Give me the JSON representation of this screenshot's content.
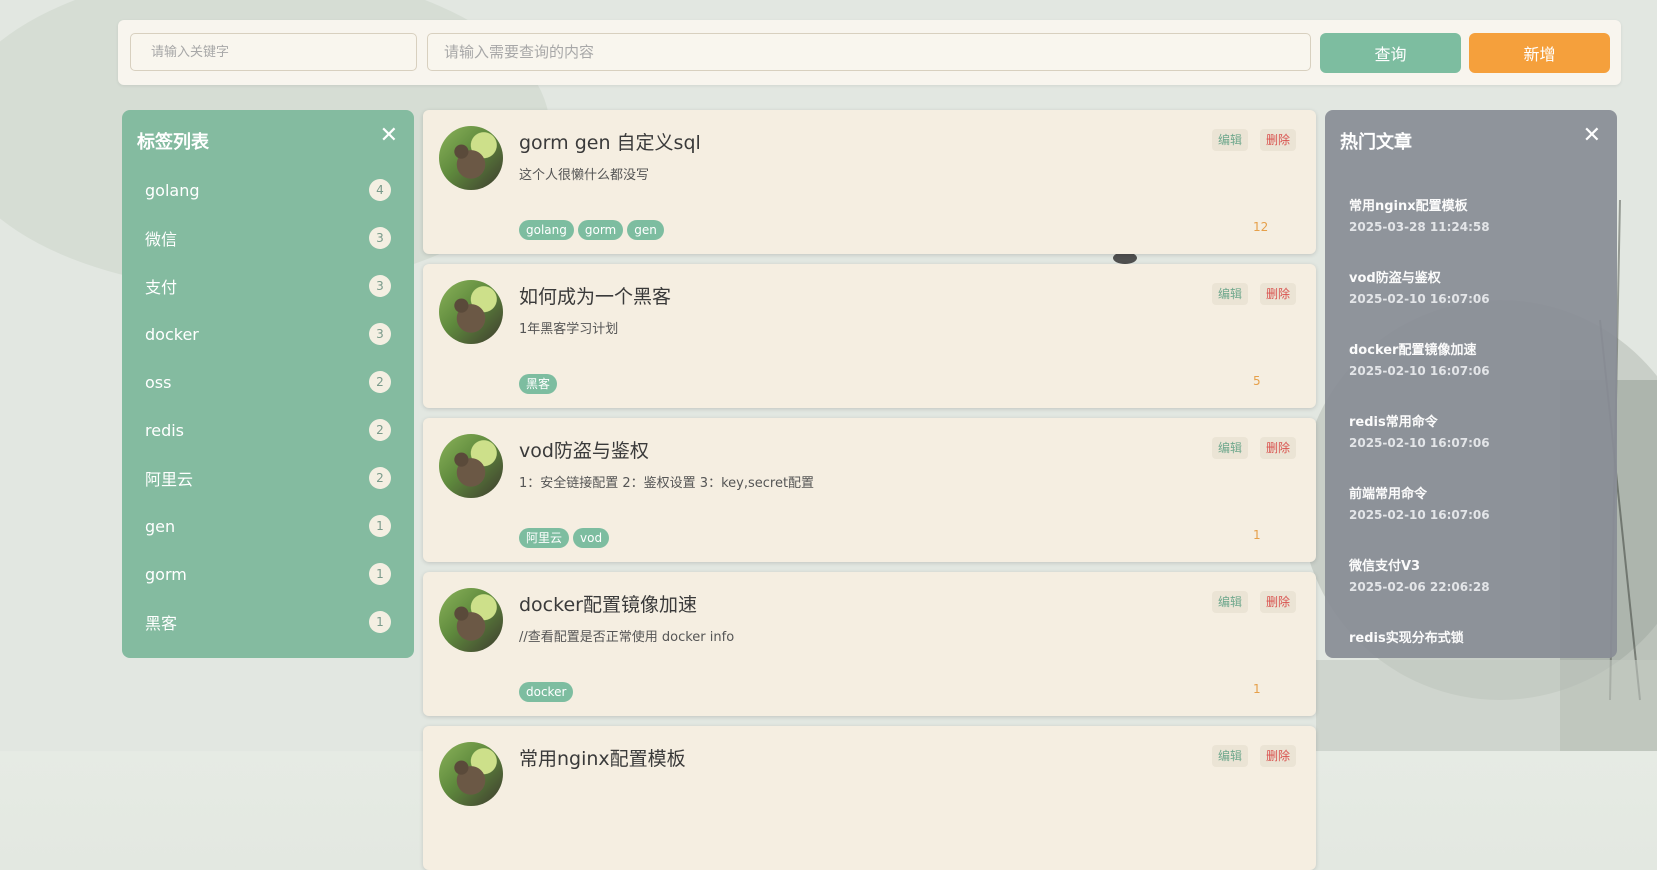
{
  "search": {
    "keyword_placeholder": "请输入关键字",
    "query_placeholder": "请输入需要查询的内容",
    "search_label": "查询",
    "add_label": "新增"
  },
  "tags_panel": {
    "title": "标签列表",
    "close_glyph": "✕",
    "items": [
      {
        "name": "golang",
        "count": "4"
      },
      {
        "name": "微信",
        "count": "3"
      },
      {
        "name": "支付",
        "count": "3"
      },
      {
        "name": "docker",
        "count": "3"
      },
      {
        "name": "oss",
        "count": "2"
      },
      {
        "name": "redis",
        "count": "2"
      },
      {
        "name": "阿里云",
        "count": "2"
      },
      {
        "name": "gen",
        "count": "1"
      },
      {
        "name": "gorm",
        "count": "1"
      },
      {
        "name": "黑客",
        "count": "1"
      }
    ]
  },
  "articles": {
    "edit_label": "编辑",
    "delete_label": "删除",
    "items": [
      {
        "title": "gorm gen 自定义sql",
        "desc": "这个人很懒什么都没写",
        "tags": [
          "golang",
          "gorm",
          "gen"
        ],
        "count": "12"
      },
      {
        "title": "如何成为一个黑客",
        "desc": "1年黑客学习计划",
        "tags": [
          "黑客"
        ],
        "count": "5"
      },
      {
        "title": "vod防盗与鉴权",
        "desc": "1：安全链接配置 2：鉴权设置 3：key,secret配置",
        "tags": [
          "阿里云",
          "vod"
        ],
        "count": "1"
      },
      {
        "title": "docker配置镜像加速",
        "desc": "//查看配置是否正常使用 docker info",
        "tags": [
          "docker"
        ],
        "count": "1"
      },
      {
        "title": "常用nginx配置模板",
        "desc": "",
        "tags": [],
        "count": ""
      }
    ]
  },
  "hot_panel": {
    "title": "热门文章",
    "close_glyph": "✕",
    "items": [
      {
        "title": "常用nginx配置模板",
        "date": "2025-03-28 11:24:58"
      },
      {
        "title": "vod防盗与鉴权",
        "date": "2025-02-10 16:07:06"
      },
      {
        "title": "docker配置镜像加速",
        "date": "2025-02-10 16:07:06"
      },
      {
        "title": "redis常用命令",
        "date": "2025-02-10 16:07:06"
      },
      {
        "title": "前端常用命令",
        "date": "2025-02-10 16:07:06"
      },
      {
        "title": "微信支付V3",
        "date": "2025-02-06 22:06:28"
      },
      {
        "title": "redis实现分布式锁",
        "date": ""
      }
    ]
  },
  "colors": {
    "accent_green": "#7dbda0",
    "accent_orange": "#f5a03c",
    "card_bg": "#f5eee1",
    "hot_panel_bg": "#898d96"
  }
}
